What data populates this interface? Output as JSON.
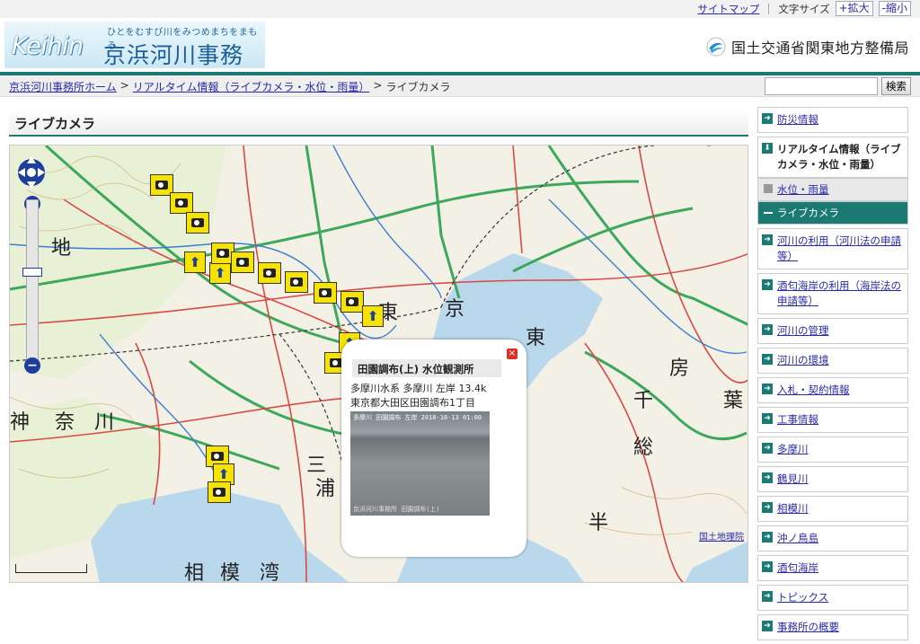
{
  "utility": {
    "sitemap": "サイトマップ",
    "font_size_label": "文字サイズ",
    "enlarge": "+拡大",
    "shrink": "-縮小"
  },
  "header": {
    "logo_latin": "Keihin",
    "logo_tagline": "ひとをむすび川をみつめまちをまもる",
    "logo_jp": "京浜河川事務所",
    "ministry": "国土交通省関東地方整備局"
  },
  "breadcrumb": {
    "items": [
      "京浜河川事務所ホーム",
      "リアルタイム情報（ライブカメラ・水位・雨量）"
    ],
    "separator": ">",
    "current": "ライブカメラ"
  },
  "search": {
    "button": "検索",
    "value": ""
  },
  "page": {
    "title": "ライブカメラ"
  },
  "map": {
    "labels": {
      "tokyo_1": "東",
      "tokyo_2": "京",
      "chiba_1": "千",
      "chiba_2": "葉",
      "kanagawa_1": "奈",
      "kanagawa_2": "川",
      "kanagawa_0": "神",
      "boso_1": "房",
      "boso_2": "総",
      "miura_1": "三",
      "miura_2": "浦",
      "sagami_1": "相",
      "sagami_2": "模",
      "sagami_3": "湾",
      "east_1": "東",
      "han": "半",
      "chi2": "地"
    },
    "gsi_link": "国土地理院",
    "popup": {
      "title": "田園調布(上) 水位観測所",
      "line1": "多摩川水系 多摩川 左岸 13.4k",
      "line2": "東京都大田区田園調布1丁目",
      "stamp": "多摩川 田園調布 左岸 2018-10-13 01:00",
      "stamp2": "京浜河川事務所 田園調布(上)"
    }
  },
  "sidebar": {
    "items": [
      {
        "label": "防災情報",
        "type": "link"
      },
      {
        "label": "リアルタイム情報（ライブカメラ・水位・雨量）",
        "type": "expanded"
      },
      {
        "label": "水位・雨量",
        "type": "sub"
      },
      {
        "label": "ライブカメラ",
        "type": "sub-active"
      },
      {
        "label": "河川の利用（河川法の申請等）",
        "type": "link"
      },
      {
        "label": "酒匂海岸の利用（海岸法の申請等）",
        "type": "link"
      },
      {
        "label": "河川の管理",
        "type": "link"
      },
      {
        "label": "河川の環境",
        "type": "link"
      },
      {
        "label": "入札・契約情報",
        "type": "link"
      },
      {
        "label": "工事情報",
        "type": "link"
      },
      {
        "label": "多摩川",
        "type": "link"
      },
      {
        "label": "鶴見川",
        "type": "link"
      },
      {
        "label": "相模川",
        "type": "link"
      },
      {
        "label": "沖ノ鳥島",
        "type": "link"
      },
      {
        "label": "酒匂海岸",
        "type": "link"
      },
      {
        "label": "トピックス",
        "type": "link"
      },
      {
        "label": "事務所の概要",
        "type": "link"
      }
    ]
  }
}
